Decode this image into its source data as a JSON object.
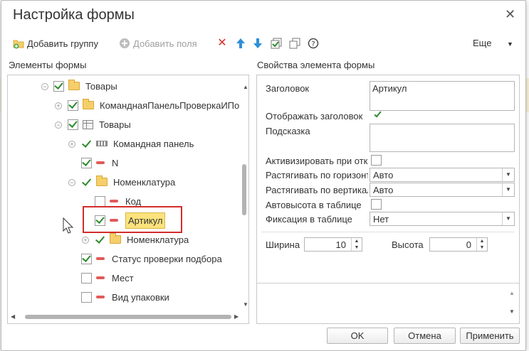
{
  "dialog": {
    "title": "Настройка формы"
  },
  "toolbar": {
    "add_group": "Добавить группу",
    "add_fields": "Добавить поля",
    "more": "Еще"
  },
  "sections": {
    "tree_title": "Элементы формы",
    "props_title": "Свойства элемента формы"
  },
  "tree": {
    "items": [
      {
        "label": "Товары",
        "type": "group",
        "checked": true,
        "expander": "minus"
      },
      {
        "label": "КоманднаяПанельПроверкаИПо",
        "type": "group",
        "checked": true,
        "expander": "plus"
      },
      {
        "label": "Товары",
        "type": "table",
        "checked": true,
        "expander": "minus"
      },
      {
        "label": "Командная панель",
        "type": "command-bar",
        "checked": true,
        "expander": "plus"
      },
      {
        "label": "N",
        "type": "field",
        "checked": true
      },
      {
        "label": "Номенклатура",
        "type": "group",
        "checked": true,
        "expander": "minus"
      },
      {
        "label": "Код",
        "type": "field",
        "checked": false
      },
      {
        "label": "Артикул",
        "type": "field",
        "checked": true,
        "selected": true
      },
      {
        "label": "Номенклатура",
        "type": "group",
        "checked": true,
        "expander": "plus"
      },
      {
        "label": "Статус проверки подбора",
        "type": "field",
        "checked": true
      },
      {
        "label": "Мест",
        "type": "field",
        "checked": false
      },
      {
        "label": "Вид упаковки",
        "type": "field",
        "checked": false
      }
    ]
  },
  "properties": {
    "caption_label": "Заголовок",
    "caption_value": "Артикул",
    "show_caption_label": "Отображать заголовок",
    "show_caption_checked": true,
    "tooltip_label": "Подсказка",
    "tooltip_value": "",
    "activate_label": "Активизировать при открытии",
    "activate_checked": false,
    "stretch_h_label": "Растягивать по горизонтали",
    "stretch_h_value": "Авто",
    "stretch_v_label": "Растягивать по вертикали",
    "stretch_v_value": "Авто",
    "auto_height_label": "Автовысота в таблице",
    "auto_height_checked": false,
    "fixing_label": "Фиксация в таблице",
    "fixing_value": "Нет",
    "width_label": "Ширина",
    "width_value": "10",
    "height_label": "Высота",
    "height_value": "0"
  },
  "buttons": {
    "ok": "OK",
    "cancel": "Отмена",
    "apply": "Применить"
  },
  "colors": {
    "check_green": "#2e8b2e",
    "selection_yellow": "#fbe27c",
    "highlight_red": "#d22c2c",
    "field_red": "#e05a5a",
    "folder_yellow": "#f6cf6a"
  }
}
